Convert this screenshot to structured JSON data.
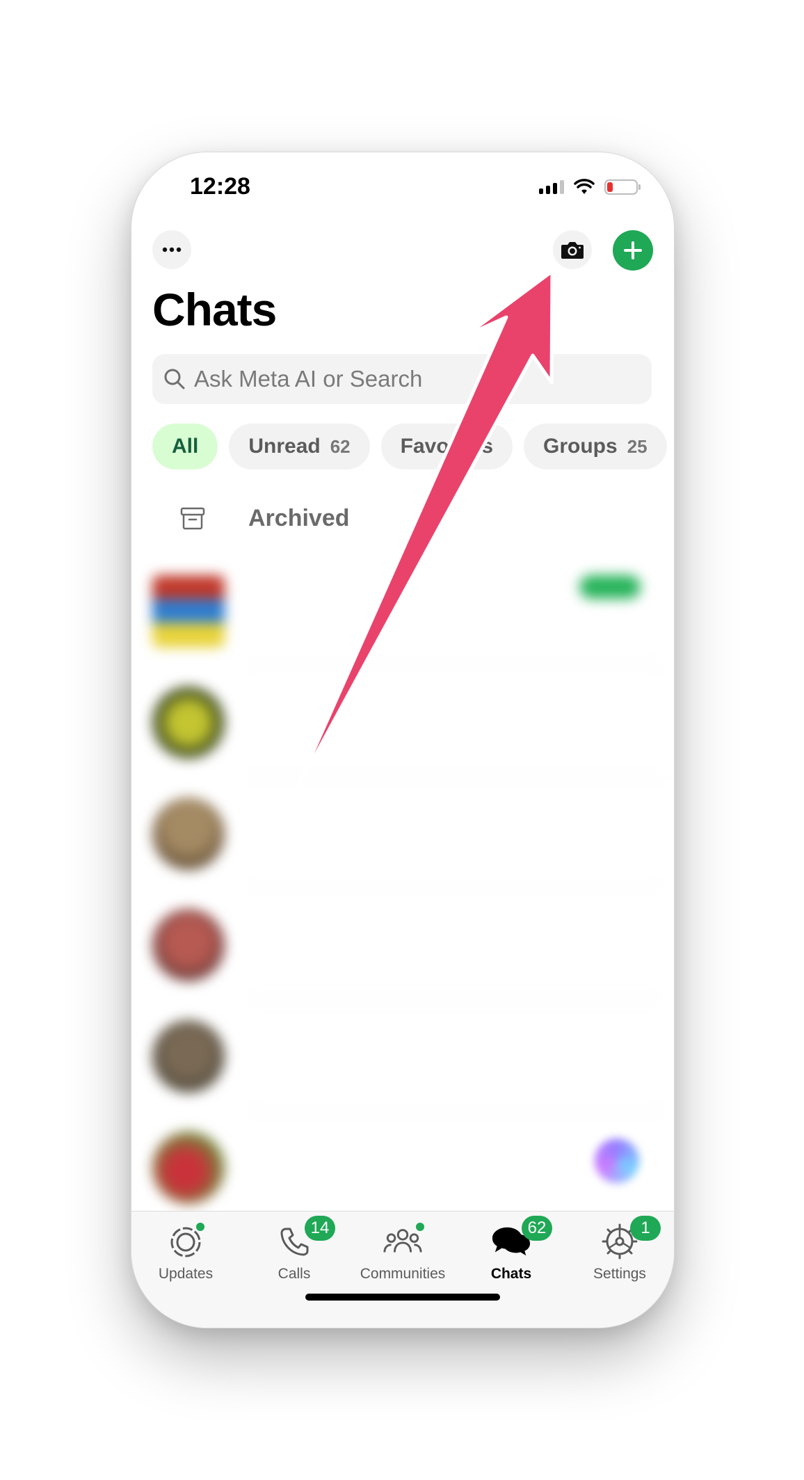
{
  "status_bar": {
    "time": "12:28"
  },
  "header": {
    "title": "Chats"
  },
  "search": {
    "placeholder": "Ask Meta AI or Search"
  },
  "filters": [
    {
      "label": "All",
      "count": ""
    },
    {
      "label": "Unread",
      "count": "62"
    },
    {
      "label": "Favorites",
      "count": ""
    },
    {
      "label": "Groups",
      "count": "25"
    }
  ],
  "archived": {
    "label": "Archived"
  },
  "tabs": [
    {
      "label": "Updates",
      "badge": ""
    },
    {
      "label": "Calls",
      "badge": "14"
    },
    {
      "label": "Communities",
      "badge": ""
    },
    {
      "label": "Chats",
      "badge": "62"
    },
    {
      "label": "Settings",
      "badge": "1"
    }
  ],
  "colors": {
    "accent_green": "#1fa855",
    "active_chip_bg": "#d9fdd3",
    "annotation_arrow": "#e9436b"
  },
  "icons": [
    "more-icon",
    "camera-icon",
    "plus-icon",
    "search-icon",
    "archive-icon",
    "updates-icon",
    "phone-icon",
    "communities-icon",
    "chats-icon",
    "settings-icon"
  ]
}
